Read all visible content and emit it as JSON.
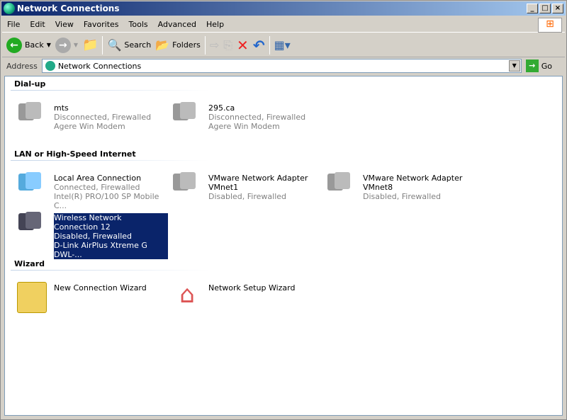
{
  "window": {
    "title": "Network Connections",
    "min": "_",
    "max": "□",
    "close": "×"
  },
  "menu": [
    "File",
    "Edit",
    "View",
    "Favorites",
    "Tools",
    "Advanced",
    "Help"
  ],
  "toolbar": {
    "back": "Back",
    "search": "Search",
    "folders": "Folders"
  },
  "address": {
    "label": "Address",
    "value": "Network Connections",
    "go": "Go"
  },
  "groups": [
    {
      "title": "Dial-up",
      "items": [
        {
          "name": "mts",
          "status": "Disconnected, Firewalled",
          "device": "Agere Win Modem"
        },
        {
          "name": "295.ca",
          "status": "Disconnected, Firewalled",
          "device": "Agere Win Modem"
        }
      ]
    },
    {
      "title": "LAN or High-Speed Internet",
      "items": [
        {
          "name": "Local Area Connection",
          "status": "Connected, Firewalled",
          "device": "Intel(R) PRO/100 SP Mobile C..."
        },
        {
          "name": "VMware Network Adapter",
          "name2": "VMnet1",
          "status": "Disabled, Firewalled"
        },
        {
          "name": "VMware Network Adapter",
          "name2": "VMnet8",
          "status": "Disabled, Firewalled"
        },
        {
          "name": "Wireless Network Connection 12",
          "status": "Disabled, Firewalled",
          "device": "D-Link AirPlus Xtreme G DWL-..."
        }
      ]
    },
    {
      "title": "Wizard",
      "items": [
        {
          "name": "New Connection Wizard"
        },
        {
          "name": "Network Setup Wizard"
        }
      ]
    }
  ]
}
